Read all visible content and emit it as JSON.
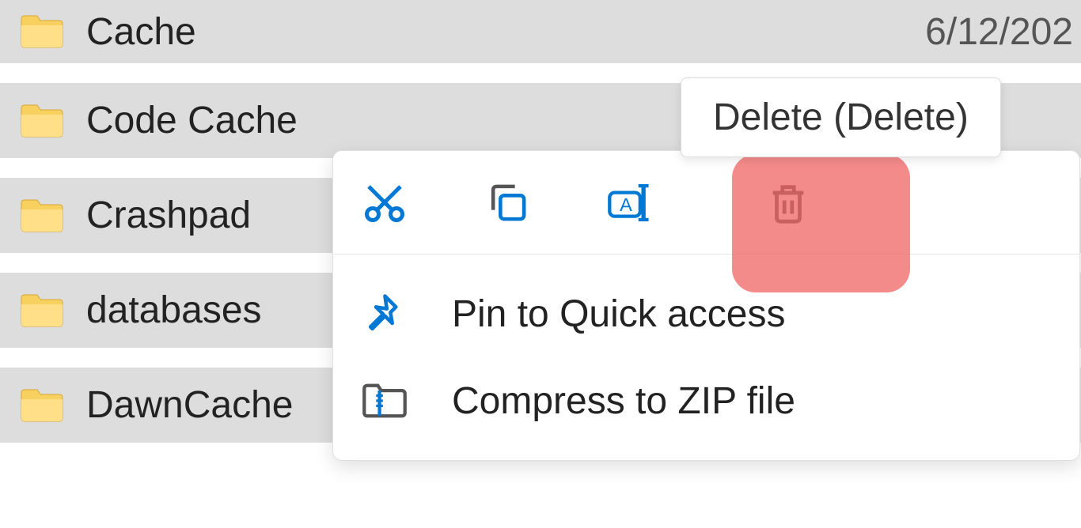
{
  "files": [
    {
      "name": "Cache",
      "date": "6/12/202"
    },
    {
      "name": "Code Cache",
      "date": ""
    },
    {
      "name": "Crashpad",
      "date": ""
    },
    {
      "name": "databases",
      "date": ""
    },
    {
      "name": "DawnCache",
      "date": ""
    }
  ],
  "tooltip": "Delete (Delete)",
  "contextMenu": {
    "items": [
      {
        "label": "Pin to Quick access"
      },
      {
        "label": "Compress to ZIP file"
      }
    ]
  }
}
